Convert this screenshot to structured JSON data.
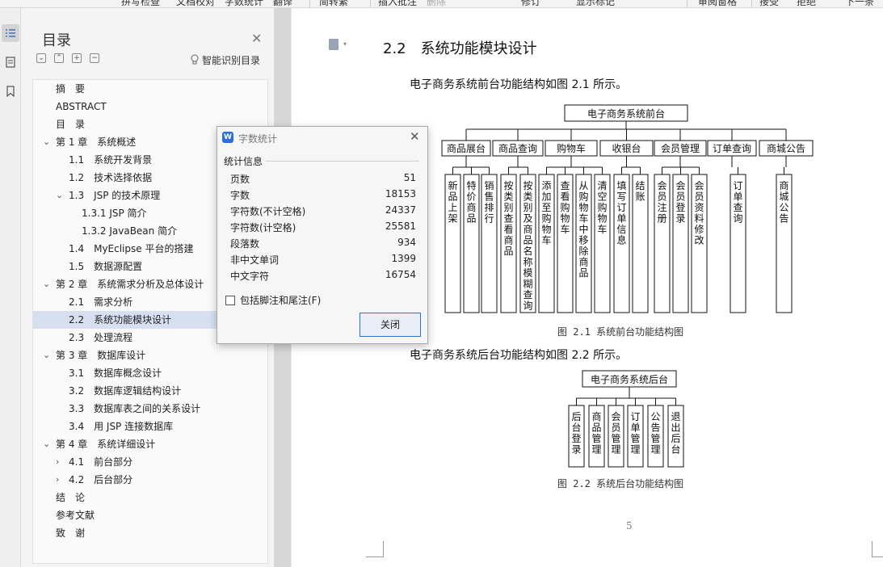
{
  "ribbon": {
    "items": [
      "拼写检查",
      "文档校对",
      "字数统计",
      "翻译",
      "简转繁",
      "插入批注",
      "删除",
      "修订",
      "显示标记",
      "审阅窗格",
      "接受",
      "拒绝",
      "下一条"
    ]
  },
  "rail": {
    "icons": [
      "toc-icon",
      "pages-icon",
      "bookmark-icon"
    ]
  },
  "toc": {
    "title": "目录",
    "smart_label": "智能识别目录",
    "items": [
      {
        "label": "摘　要"
      },
      {
        "label": "ABSTRACT"
      },
      {
        "label": "目　录"
      },
      {
        "label": "第 1 章　系统概述"
      },
      {
        "label": "1.1　系统开发背景"
      },
      {
        "label": "1.2　技术选择依据"
      },
      {
        "label": "1.3　JSP 的技术原理"
      },
      {
        "label": "1.3.1 JSP 简介"
      },
      {
        "label": "1.3.2 JavaBean 简介"
      },
      {
        "label": "1.4　MyEclipse 平台的搭建"
      },
      {
        "label": "1.5　数据源配置"
      },
      {
        "label": "第 2 章　系统需求分析及总体设计"
      },
      {
        "label": "2.1　需求分析"
      },
      {
        "label": "2.2　系统功能模块设计"
      },
      {
        "label": "2.3　处理流程"
      },
      {
        "label": "第 3 章　数据库设计"
      },
      {
        "label": "3.1　数据库概念设计"
      },
      {
        "label": "3.2　数据库逻辑结构设计"
      },
      {
        "label": "3.3　数据库表之间的关系设计"
      },
      {
        "label": "3.4　用 JSP 连接数据库"
      },
      {
        "label": "第 4 章　系统详细设计"
      },
      {
        "label": "4.1　前台部分"
      },
      {
        "label": "4.2　后台部分"
      },
      {
        "label": "结　论"
      },
      {
        "label": "参考文献"
      },
      {
        "label": "致　谢"
      }
    ]
  },
  "document": {
    "heading": "2.2　系统功能模块设计",
    "para1": "电子商务系统前台功能结构如图 2.1 所示。",
    "caption1": "图 2.1  系统前台功能结构图",
    "para2": "电子商务系统后台功能结构如图 2.2 所示。",
    "caption2": "图 2.2  系统后台功能结构图",
    "page_number": "5",
    "front_diagram": {
      "root": "电子商务系统前台",
      "modules": [
        {
          "name": "商品展台",
          "leaves": [
            "新品上架",
            "特价商品",
            "销售排行"
          ]
        },
        {
          "name": "商品查询",
          "leaves": [
            "按类别查看商品",
            "按类别及商品名称模糊查询"
          ]
        },
        {
          "name": "购物车",
          "leaves": [
            "添加至购物车",
            "查看购物车",
            "从购物车中移除商品",
            "清空购物车"
          ]
        },
        {
          "name": "收银台",
          "leaves": [
            "填写订单信息",
            "结账"
          ]
        },
        {
          "name": "会员管理",
          "leaves": [
            "会员注册",
            "会员登录",
            "会员资料修改"
          ]
        },
        {
          "name": "订单查询",
          "leaves": [
            "订单查询"
          ]
        },
        {
          "name": "商城公告",
          "leaves": [
            "商城公告"
          ]
        }
      ]
    },
    "back_diagram": {
      "root": "电子商务系统后台",
      "leaves": [
        "后台登录",
        "商品管理",
        "会员管理",
        "订单管理",
        "公告管理",
        "退出后台"
      ]
    }
  },
  "dialog": {
    "title": "字数统计",
    "section": "统计信息",
    "stats": [
      {
        "key": "页数",
        "value": "51"
      },
      {
        "key": "字数",
        "value": "18153"
      },
      {
        "key": "字符数(不计空格)",
        "value": "24337"
      },
      {
        "key": "字符数(计空格)",
        "value": "25581"
      },
      {
        "key": "段落数",
        "value": "934"
      },
      {
        "key": "非中文单词",
        "value": "1399"
      },
      {
        "key": "中文字符",
        "value": "16754"
      }
    ],
    "include_footnotes_label": "包括脚注和尾注(F)",
    "include_footnotes_checked": false,
    "close_label": "关闭"
  }
}
